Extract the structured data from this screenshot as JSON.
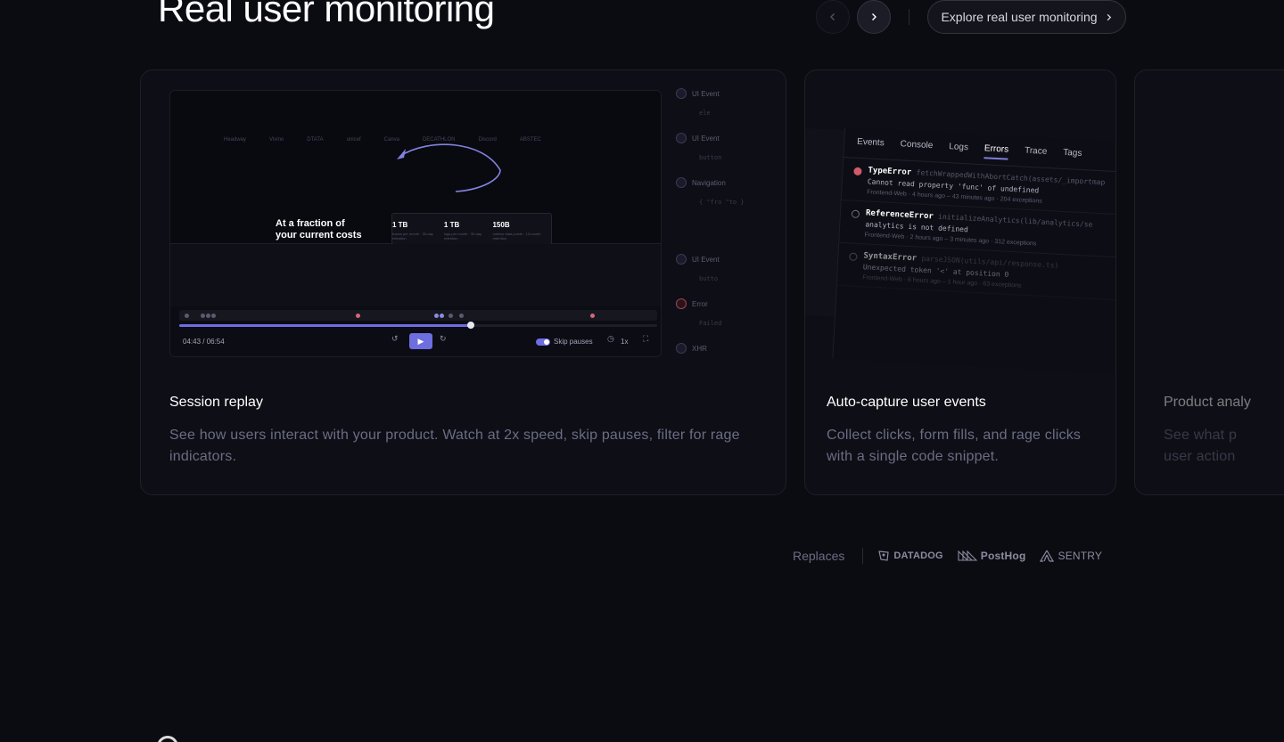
{
  "header": {
    "title": "Real user monitoring",
    "explore_label": "Explore real user monitoring",
    "prev_icon": "chevron-left-icon",
    "next_icon": "chevron-right-icon"
  },
  "cards": [
    {
      "title": "Session replay",
      "description": "See how users interact with your product. Watch at 2x speed, skip pauses, filter for rage indicators.",
      "preview": {
        "headline_line1": "At a fraction of",
        "headline_line2": "your current costs",
        "stats": [
          {
            "value": "1 TB",
            "caption": "traces per month · 30-day retention"
          },
          {
            "value": "1 TB",
            "caption": "logs per month · 30-day retention"
          },
          {
            "value": "150B",
            "caption": "metrics data points · 13-month retention"
          }
        ],
        "logos": [
          "Headway",
          "Vivino",
          "DTATA",
          "unicef",
          "Canva",
          "DECATHLON",
          "Discord",
          "ABSTEC"
        ],
        "time": "04:43 / 06:54",
        "skip_label": "Skip pauses",
        "speed": "1x",
        "progress": 0.61,
        "events": [
          {
            "label": "UI Event",
            "sub": "ele"
          },
          {
            "label": "UI Event",
            "sub": "button"
          },
          {
            "label": "Navigation",
            "sub": "{ \"fro \"to }"
          },
          {
            "label": "UI Event",
            "sub": "butto"
          },
          {
            "label": "Error",
            "sub": "Failed"
          },
          {
            "label": "XHR",
            "sub": ""
          }
        ]
      }
    },
    {
      "title": "Auto-capture user events",
      "description": "Collect clicks, form fills, and rage clicks with a single code snippet.",
      "preview": {
        "tabs": [
          "Events",
          "Console",
          "Logs",
          "Errors",
          "Trace",
          "Tags"
        ],
        "active_tab": "Errors",
        "errors": [
          {
            "name": "TypeError",
            "path": "fetchWrappedWithAbortCatch(assets/_importmap",
            "message": "Cannot read property 'func' of undefined",
            "meta": "Frontend-Web · 4 hours ago – 43 minutes ago · 204 exceptions"
          },
          {
            "name": "ReferenceError",
            "path": "initializeAnalytics(lib/analytics/se",
            "message": "analytics is not defined",
            "meta": "Frontend-Web · 2 hours ago – 3 minutes ago · 312 exceptions"
          },
          {
            "name": "SyntaxError",
            "path": "parseJSON(utils/api/response.ts)",
            "message": "Unexpected token '<' at position 0",
            "meta": "Frontend-Web · 6 hours ago – 1 hour ago · 63 exceptions"
          }
        ]
      }
    },
    {
      "title": "Product analy",
      "description_line1": "See what p",
      "description_line2": "user action"
    }
  ],
  "replaces": {
    "label": "Replaces",
    "brands": [
      "DATADOG",
      "PostHog",
      "SENTRY"
    ]
  },
  "colors": {
    "background": "#0b0b12",
    "accent": "#6d6ee0",
    "muted_text": "#6a6d84",
    "error_red": "#d05a6a"
  }
}
